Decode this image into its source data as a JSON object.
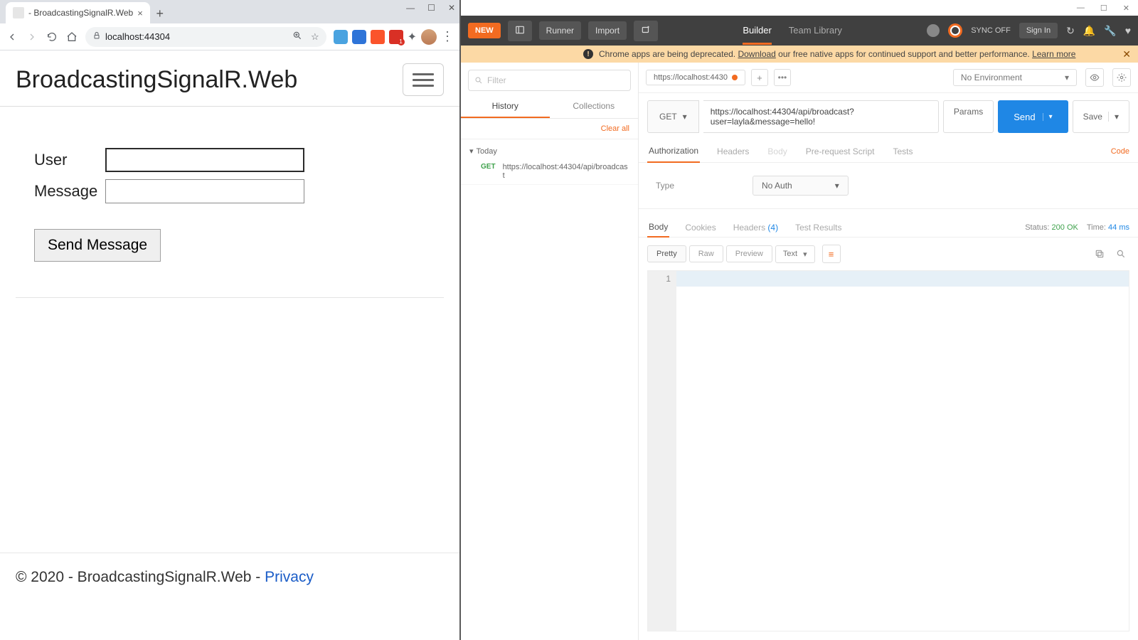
{
  "chrome": {
    "tab_title": " - BroadcastingSignalR.Web",
    "url": "localhost:44304",
    "page": {
      "brand": "BroadcastingSignalR.Web",
      "user_label": "User",
      "message_label": "Message",
      "send_button": "Send Message",
      "footer_pre": "© 2020 - BroadcastingSignalR.Web - ",
      "footer_link": "Privacy"
    }
  },
  "postman": {
    "header": {
      "new": "NEW",
      "runner": "Runner",
      "import": "Import",
      "builder": "Builder",
      "team": "Team Library",
      "sync": "SYNC OFF",
      "signin": "Sign In"
    },
    "banner": {
      "pre": "Chrome apps are being deprecated. ",
      "download": "Download",
      "mid": " our free native apps for continued support and better performance. ",
      "learn": "Learn more"
    },
    "sidebar": {
      "filter_placeholder": "Filter",
      "tabs": {
        "history": "History",
        "collections": "Collections"
      },
      "clear": "Clear all",
      "today": "Today",
      "item": {
        "method": "GET",
        "url": "https://localhost:44304/api/broadcast"
      }
    },
    "request": {
      "tab_label": "https://localhost:4430",
      "env": "No Environment",
      "method": "GET",
      "url": "https://localhost:44304/api/broadcast?user=layla&message=hello!",
      "params": "Params",
      "send": "Send",
      "save": "Save",
      "tabs": {
        "auth": "Authorization",
        "headers": "Headers",
        "body": "Body",
        "prereq": "Pre-request Script",
        "tests": "Tests",
        "code": "Code"
      },
      "auth": {
        "type_label": "Type",
        "value": "No Auth"
      }
    },
    "response": {
      "tabs": {
        "body": "Body",
        "cookies": "Cookies",
        "headers": "Headers",
        "hcount": "(4)",
        "tests": "Test Results"
      },
      "status_label": "Status:",
      "status_value": "200 OK",
      "time_label": "Time:",
      "time_value": "44 ms",
      "view": {
        "pretty": "Pretty",
        "raw": "Raw",
        "preview": "Preview",
        "format": "Text"
      },
      "line_no": "1"
    }
  }
}
